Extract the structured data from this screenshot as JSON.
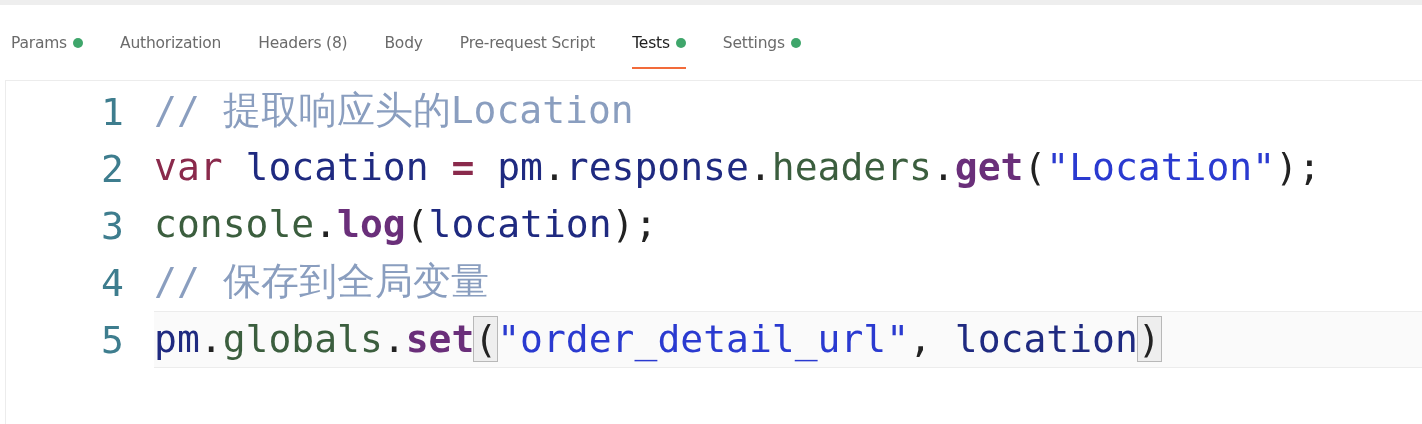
{
  "tabs": [
    {
      "label": "Params",
      "selected": false,
      "dot": true
    },
    {
      "label": "Authorization",
      "selected": false,
      "dot": false
    },
    {
      "label": "Headers (8)",
      "selected": false,
      "dot": false
    },
    {
      "label": "Body",
      "selected": false,
      "dot": false
    },
    {
      "label": "Pre-request Script",
      "selected": false,
      "dot": false
    },
    {
      "label": "Tests",
      "selected": true,
      "dot": true
    },
    {
      "label": "Settings",
      "selected": false,
      "dot": true
    }
  ],
  "editor": {
    "lines": [
      {
        "number": "1",
        "active": false,
        "tokens": [
          {
            "kind": "comment",
            "text": "// 提取响应头的Location"
          }
        ]
      },
      {
        "number": "2",
        "active": false,
        "tokens": [
          {
            "kind": "keyword",
            "text": "var"
          },
          {
            "kind": "variable",
            "text": " location"
          },
          {
            "kind": "operator",
            "text": " ="
          },
          {
            "kind": "variable",
            "text": " pm"
          },
          {
            "kind": "punct",
            "text": "."
          },
          {
            "kind": "variable",
            "text": "response"
          },
          {
            "kind": "punct",
            "text": "."
          },
          {
            "kind": "property",
            "text": "headers"
          },
          {
            "kind": "punct",
            "text": "."
          },
          {
            "kind": "method",
            "text": "get"
          },
          {
            "kind": "punct",
            "text": "("
          },
          {
            "kind": "string",
            "text": "\"Location\""
          },
          {
            "kind": "punct",
            "text": ");"
          }
        ]
      },
      {
        "number": "3",
        "active": false,
        "tokens": [
          {
            "kind": "property",
            "text": "console"
          },
          {
            "kind": "punct",
            "text": "."
          },
          {
            "kind": "method",
            "text": "log"
          },
          {
            "kind": "punct",
            "text": "("
          },
          {
            "kind": "variable",
            "text": "location"
          },
          {
            "kind": "punct",
            "text": ");"
          }
        ]
      },
      {
        "number": "4",
        "active": false,
        "tokens": [
          {
            "kind": "comment",
            "text": "// 保存到全局变量"
          }
        ]
      },
      {
        "number": "5",
        "active": true,
        "tokens": [
          {
            "kind": "variable",
            "text": "pm"
          },
          {
            "kind": "punct",
            "text": "."
          },
          {
            "kind": "property",
            "text": "globals"
          },
          {
            "kind": "punct",
            "text": "."
          },
          {
            "kind": "method",
            "text": "set"
          },
          {
            "kind": "bracket",
            "text": "("
          },
          {
            "kind": "string",
            "text": "\"order_detail_url\""
          },
          {
            "kind": "punct",
            "text": ","
          },
          {
            "kind": "variable",
            "text": " location"
          },
          {
            "kind": "bracket",
            "text": ")"
          }
        ]
      }
    ]
  }
}
